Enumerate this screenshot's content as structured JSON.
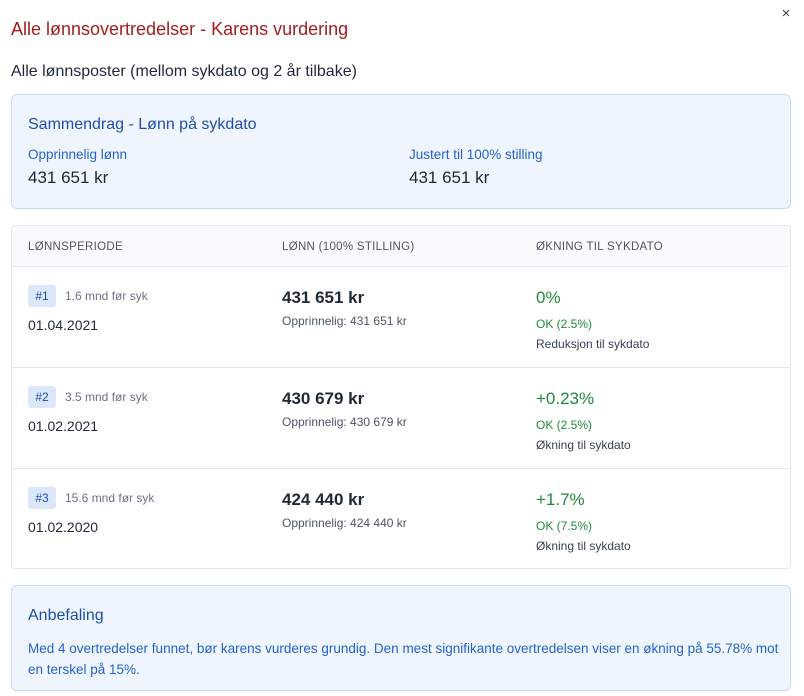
{
  "dialog": {
    "title": "Alle lønnsovertredelser - Karens vurdering",
    "close_icon": "×",
    "subtitle": "Alle lønnsposter (mellom sykdato og 2 år tilbake)"
  },
  "summary": {
    "heading": "Sammendrag - Lønn på sykdato",
    "original_label": "Opprinnelig lønn",
    "original_value": "431 651 kr",
    "adjusted_label": "Justert til 100% stilling",
    "adjusted_value": "431 651 kr"
  },
  "table": {
    "headers": [
      "LØNNSPERIODE",
      "LØNN (100% STILLING)",
      "ØKNING TIL SYKDATO"
    ],
    "rows": [
      {
        "badge": "#1",
        "months": "1.6 mnd før syk",
        "date": "01.04.2021",
        "amount": "431 651 kr",
        "original": "Opprinnelig: 431 651 kr",
        "percent": "0%",
        "status": "OK (2.5%)",
        "note": "Reduksjon til sykdato"
      },
      {
        "badge": "#2",
        "months": "3.5 mnd før syk",
        "date": "01.02.2021",
        "amount": "430 679 kr",
        "original": "Opprinnelig: 430 679 kr",
        "percent": "+0.23%",
        "status": "OK (2.5%)",
        "note": "Økning til sykdato"
      },
      {
        "badge": "#3",
        "months": "15.6 mnd før syk",
        "date": "01.02.2020",
        "amount": "424 440 kr",
        "original": "Opprinnelig: 424 440 kr",
        "percent": "+1.7%",
        "status": "OK (7.5%)",
        "note": "Økning til sykdato"
      }
    ]
  },
  "recommendation": {
    "heading": "Anbefaling",
    "text": "Med 4 overtredelser funnet, bør karens vurderes grundig. Den mest signifikante overtredelsen viser en økning på 55.78% mot en terskel på 15%."
  },
  "colors": {
    "title": "#a51d1d",
    "accent": "#1e4ea8",
    "ok_green": "#1f8a3b",
    "panel_bg": "#eff5ff"
  }
}
